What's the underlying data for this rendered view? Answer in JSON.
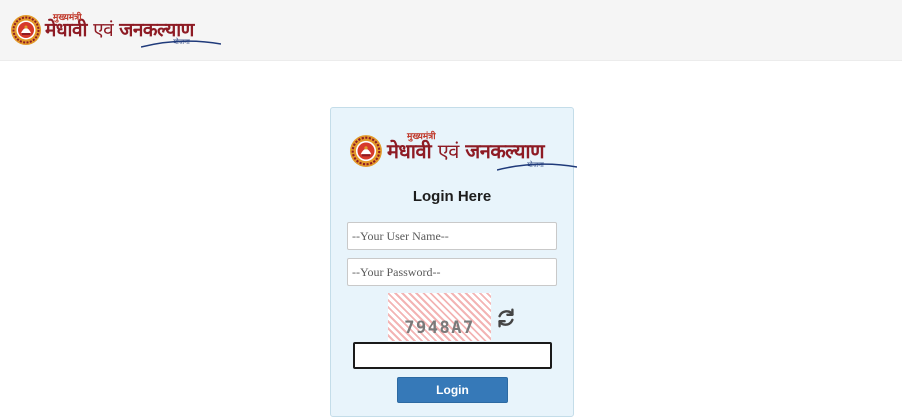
{
  "header": {
    "logo": {
      "small": "मुख्यमंत्री",
      "main_a": "मेधावी",
      "main_b": "एवं",
      "main_c": "जनकल्याण",
      "tag": "योजना"
    }
  },
  "card": {
    "logo": {
      "small": "मुख्यमंत्री",
      "main_a": "मेधावी",
      "main_b": "एवं",
      "main_c": "जनकल्याण",
      "tag": "योजना"
    },
    "title": "Login Here",
    "username_placeholder": "--Your User Name--",
    "password_placeholder": "--Your Password--",
    "captcha_text": "7948A7",
    "captcha_value": "",
    "login_label": "Login"
  },
  "colors": {
    "card_bg": "#e8f4fb",
    "button": "#3679b8",
    "logo_red": "#8e1b24",
    "logo_blue": "#1f3a7a"
  },
  "icons": {
    "emblem": "scheme-emblem-icon",
    "refresh": "refresh-icon"
  }
}
